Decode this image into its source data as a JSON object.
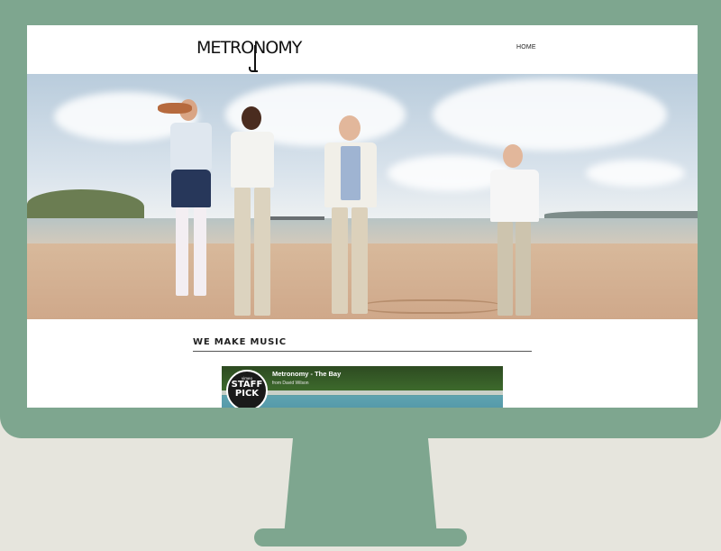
{
  "site": {
    "logo_text": "METRONOMY",
    "nav": {
      "home_label": "HOME"
    }
  },
  "content": {
    "heading": "WE MAKE MUSIC",
    "video": {
      "title": "Metronomy - The Bay",
      "byline": "from David Wilson",
      "badge_small": "vimeo",
      "badge_line1": "STAFF",
      "badge_line2": "PICK"
    }
  },
  "colors": {
    "monitor": "#7ea68f",
    "background": "#e6e5dd",
    "screen": "#ffffff"
  }
}
